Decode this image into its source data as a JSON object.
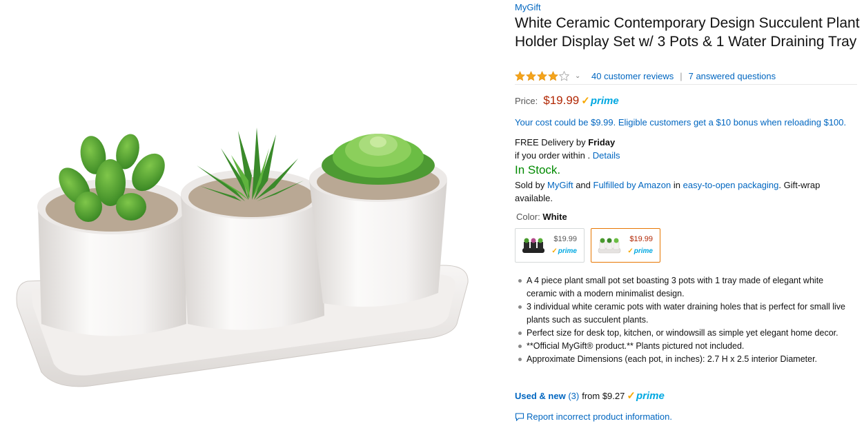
{
  "product": {
    "brand": "MyGift",
    "title": "White Ceramic Contemporary Design Succulent Plant Holder Display Set w/ 3 Pots & 1 Water Draining Tray",
    "rating": 4,
    "rating_max": 5,
    "reviews_label": "40 customer reviews",
    "questions_label": "7 answered questions"
  },
  "pricing": {
    "price_label": "Price:",
    "price": "$19.99",
    "prime_label": "prime",
    "cost_text": "Your cost could be $9.99. Eligible customers get a $10 bonus when reloading $100."
  },
  "delivery": {
    "prefix": "FREE Delivery by",
    "day": "Friday",
    "within_text": "if you order within .",
    "details_link": "Details"
  },
  "stock": "In Stock.",
  "sold_by": {
    "sold_prefix": "Sold by",
    "seller": "MyGift",
    "and": "and",
    "fulfilled": "Fulfilled by Amazon",
    "in": "in",
    "packaging": "easy-to-open packaging",
    "suffix": ". Gift-wrap available."
  },
  "color": {
    "label": "Color:",
    "value": "White",
    "options": [
      {
        "name": "Black",
        "price": "$19.99",
        "prime": "prime",
        "selected": false
      },
      {
        "name": "White",
        "price": "$19.99",
        "prime": "prime",
        "selected": true
      }
    ]
  },
  "bullets": [
    "A 4 piece plant small pot set boasting 3 pots with 1 tray made of elegant white ceramic with a modern minimalist design.",
    "3 individual white ceramic pots with water draining holes that is perfect for small live plants such as succulent plants.",
    "Perfect size for desk top, kitchen, or windowsill as simple yet elegant home decor.",
    "**Official MyGift® product.** Plants pictured not included.",
    "Approximate Dimensions (each pot, in inches): 2.7 H x 2.5 interior Diameter."
  ],
  "offers": {
    "used_new_label": "Used & new",
    "count": "(3)",
    "from": "from $9.27",
    "prime_label": "prime"
  },
  "report_link": "Report incorrect product information.",
  "colors": {
    "link": "#0066c0",
    "price": "#b12704",
    "in_stock": "#008a00",
    "prime_blue": "#00a8e1",
    "prime_check": "#f7a800",
    "selected_border": "#e77600",
    "star": "#f4a41c"
  }
}
